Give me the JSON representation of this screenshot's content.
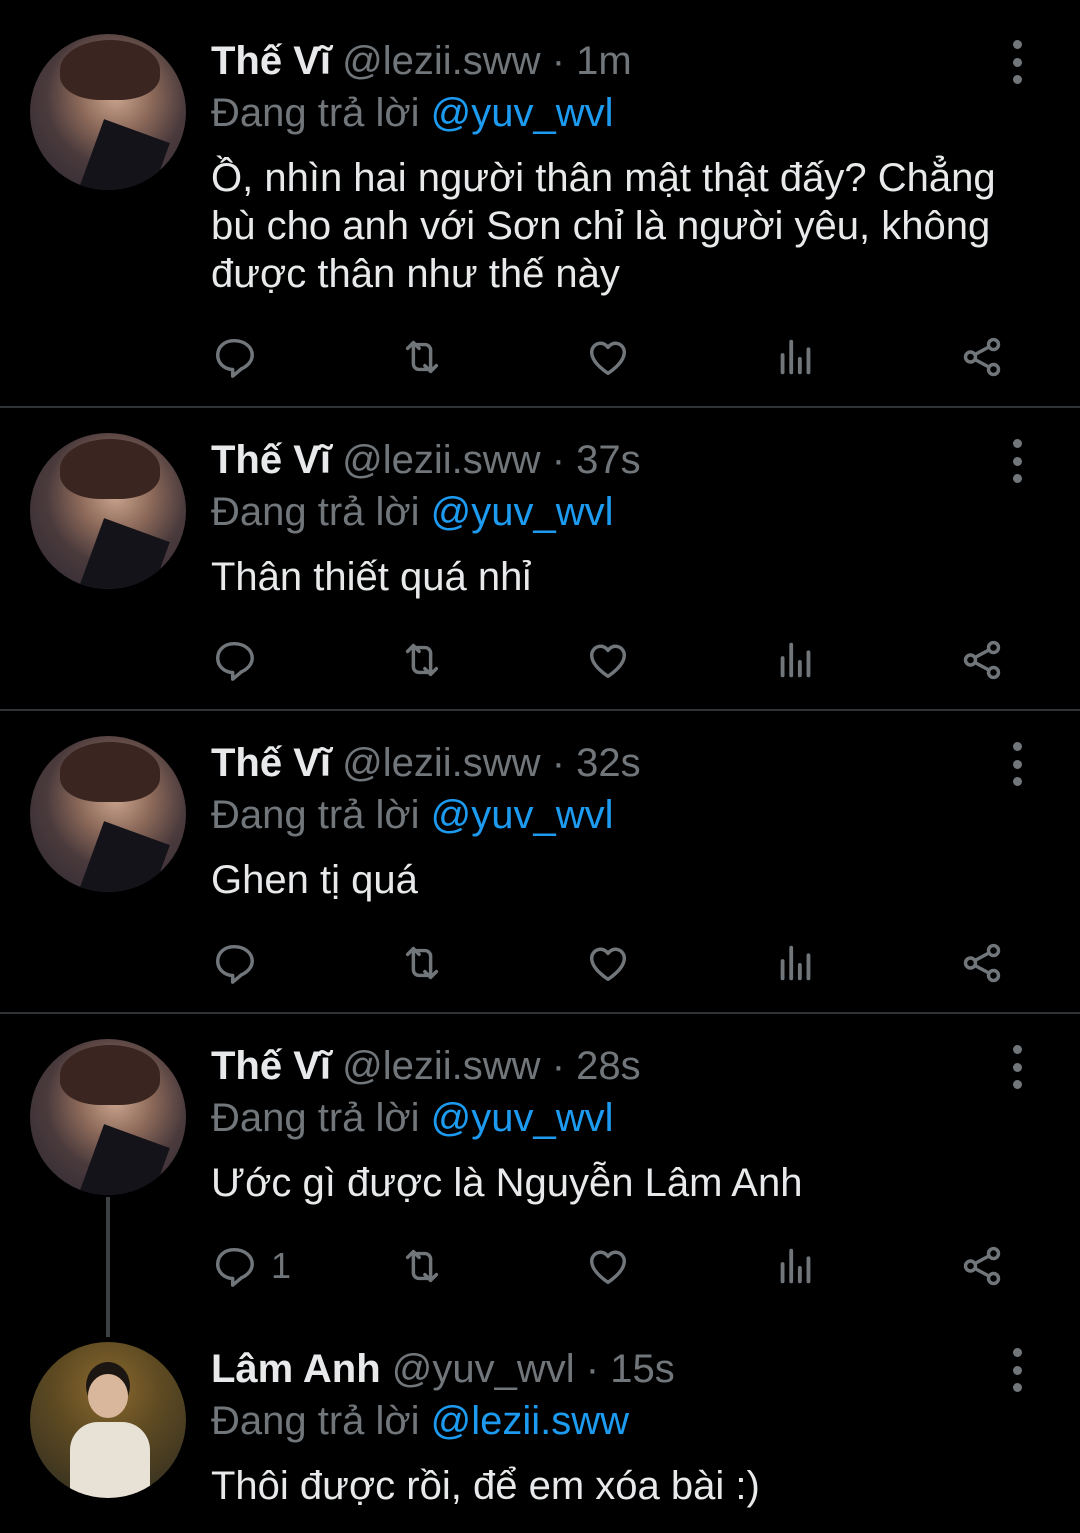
{
  "colors": {
    "background": "#000000",
    "text": "#e7e9ea",
    "secondary": "#71767b",
    "mention": "#1d9bf0",
    "divider": "#2f3336"
  },
  "icons": {
    "reply": "reply-icon",
    "retweet": "retweet-icon",
    "like": "heart-icon",
    "views": "analytics-icon",
    "share": "share-icon",
    "more": "more-vertical-icon"
  },
  "tweets": [
    {
      "name": "Thế Vĩ",
      "handle": "@lezii.sww",
      "time": "1m",
      "reply_prefix": "Đang trả lời",
      "reply_to": "@yuv_wvl",
      "text": "Ồ, nhìn hai người thân mật thật đấy? Chẳng bù cho anh với Sơn chỉ là người yêu, không được thân như thế này",
      "reply_count": ""
    },
    {
      "name": "Thế Vĩ",
      "handle": "@lezii.sww",
      "time": "37s",
      "reply_prefix": "Đang trả lời",
      "reply_to": "@yuv_wvl",
      "text": "Thân thiết quá nhỉ",
      "reply_count": ""
    },
    {
      "name": "Thế Vĩ",
      "handle": "@lezii.sww",
      "time": "32s",
      "reply_prefix": "Đang trả lời",
      "reply_to": "@yuv_wvl",
      "text": "Ghen tị quá",
      "reply_count": ""
    },
    {
      "name": "Thế Vĩ",
      "handle": "@lezii.sww",
      "time": "28s",
      "reply_prefix": "Đang trả lời",
      "reply_to": "@yuv_wvl",
      "text": "Ước gì được là Nguyễn Lâm Anh",
      "reply_count": "1"
    },
    {
      "name": "Lâm Anh",
      "handle": "@yuv_wvl",
      "time": "15s",
      "reply_prefix": "Đang trả lời",
      "reply_to": "@lezii.sww",
      "text": "Thôi được rồi, để em xóa bài :)",
      "reply_count": ""
    }
  ],
  "separator": "·"
}
